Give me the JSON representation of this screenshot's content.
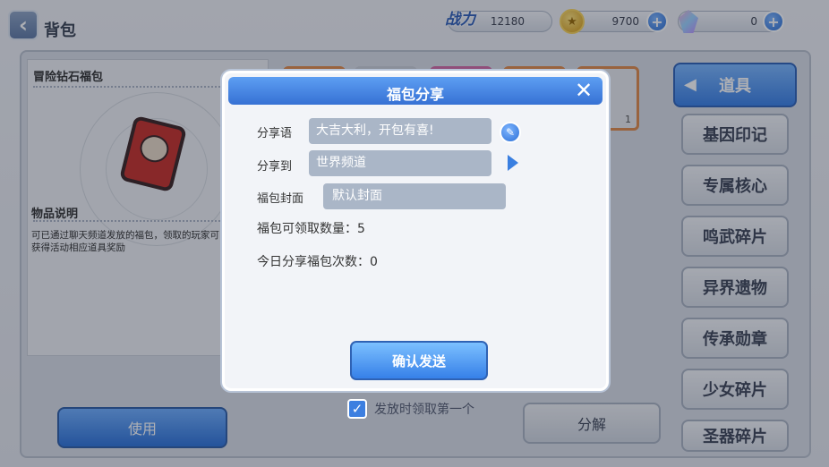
{
  "header": {
    "title": "背包",
    "power_label": "战力",
    "power_value": "12180",
    "coins_value": "9700",
    "gems_value": "0"
  },
  "item_panel": {
    "item_name": "冒险钻石福包",
    "desc_title": "物品说明",
    "desc_text": "可已通过聊天频道发放的福包，领取的玩家可获得活动相应道具奖励"
  },
  "top_slot": {
    "count": "1"
  },
  "categories": {
    "active": "道具",
    "items": [
      "基因印记",
      "专属核心",
      "鸣武碎片",
      "异界遗物",
      "传承勋章",
      "少女碎片",
      "圣器碎片"
    ]
  },
  "buttons": {
    "use": "使用",
    "decompose": "分解",
    "confirm": "确认发送"
  },
  "checkbox": {
    "label": "发放时领取第一个",
    "checked": true
  },
  "dialog": {
    "title": "福包分享",
    "share_text_label": "分享语",
    "share_text_value": "大吉大利，开包有喜!",
    "share_to_label": "分享到",
    "share_to_value": "世界频道",
    "cover_label": "福包封面",
    "cover_value": "默认封面",
    "claimable_line": "福包可领取数量：5",
    "shared_today_line": "今日分享福包次数：0"
  },
  "icons": {
    "back": "chevron-left-icon",
    "coin": "star-coin-icon",
    "gem": "crystal-gem-icon",
    "close": "close-icon",
    "edit": "pencil-icon",
    "dropdown": "triangle-right-icon"
  }
}
